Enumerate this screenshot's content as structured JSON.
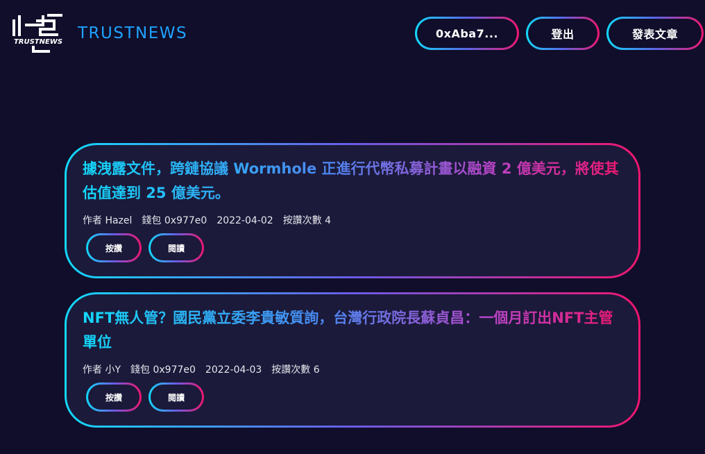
{
  "header": {
    "brand": "TRUSTNEWS",
    "logo_text": "TRUSTNEWS",
    "wallet_label": "0xAba7...",
    "logout_label": "登出",
    "publish_label": "發表文章"
  },
  "articles": [
    {
      "title": "據洩露文件，跨鏈協議 Wormhole 正進行代幣私募計畫以融資 2 億美元，將使其估值達到 25 億美元。",
      "author_label": "作者",
      "author": "Hazel",
      "wallet_label": "錢包",
      "wallet": "0x977e0",
      "date": "2022-04-02",
      "likes_label": "按讚次數",
      "likes": "4",
      "like_button": "按讚",
      "read_button": "閱讀"
    },
    {
      "title": "NFT無人管？國民黨立委李貴敏質詢，台灣行政院長蘇貞昌：一個月訂出NFT主管單位",
      "author_label": "作者",
      "author": "小Y",
      "wallet_label": "錢包",
      "wallet": "0x977e0",
      "date": "2022-04-03",
      "likes_label": "按讚次數",
      "likes": "6",
      "like_button": "按讚",
      "read_button": "閱讀"
    }
  ],
  "colors": {
    "background": "#100e2a",
    "card_background": "#1b1a3a",
    "gradient_start": "#12d8fa",
    "gradient_end": "#f0166f",
    "brand": "#1fa2ff"
  }
}
